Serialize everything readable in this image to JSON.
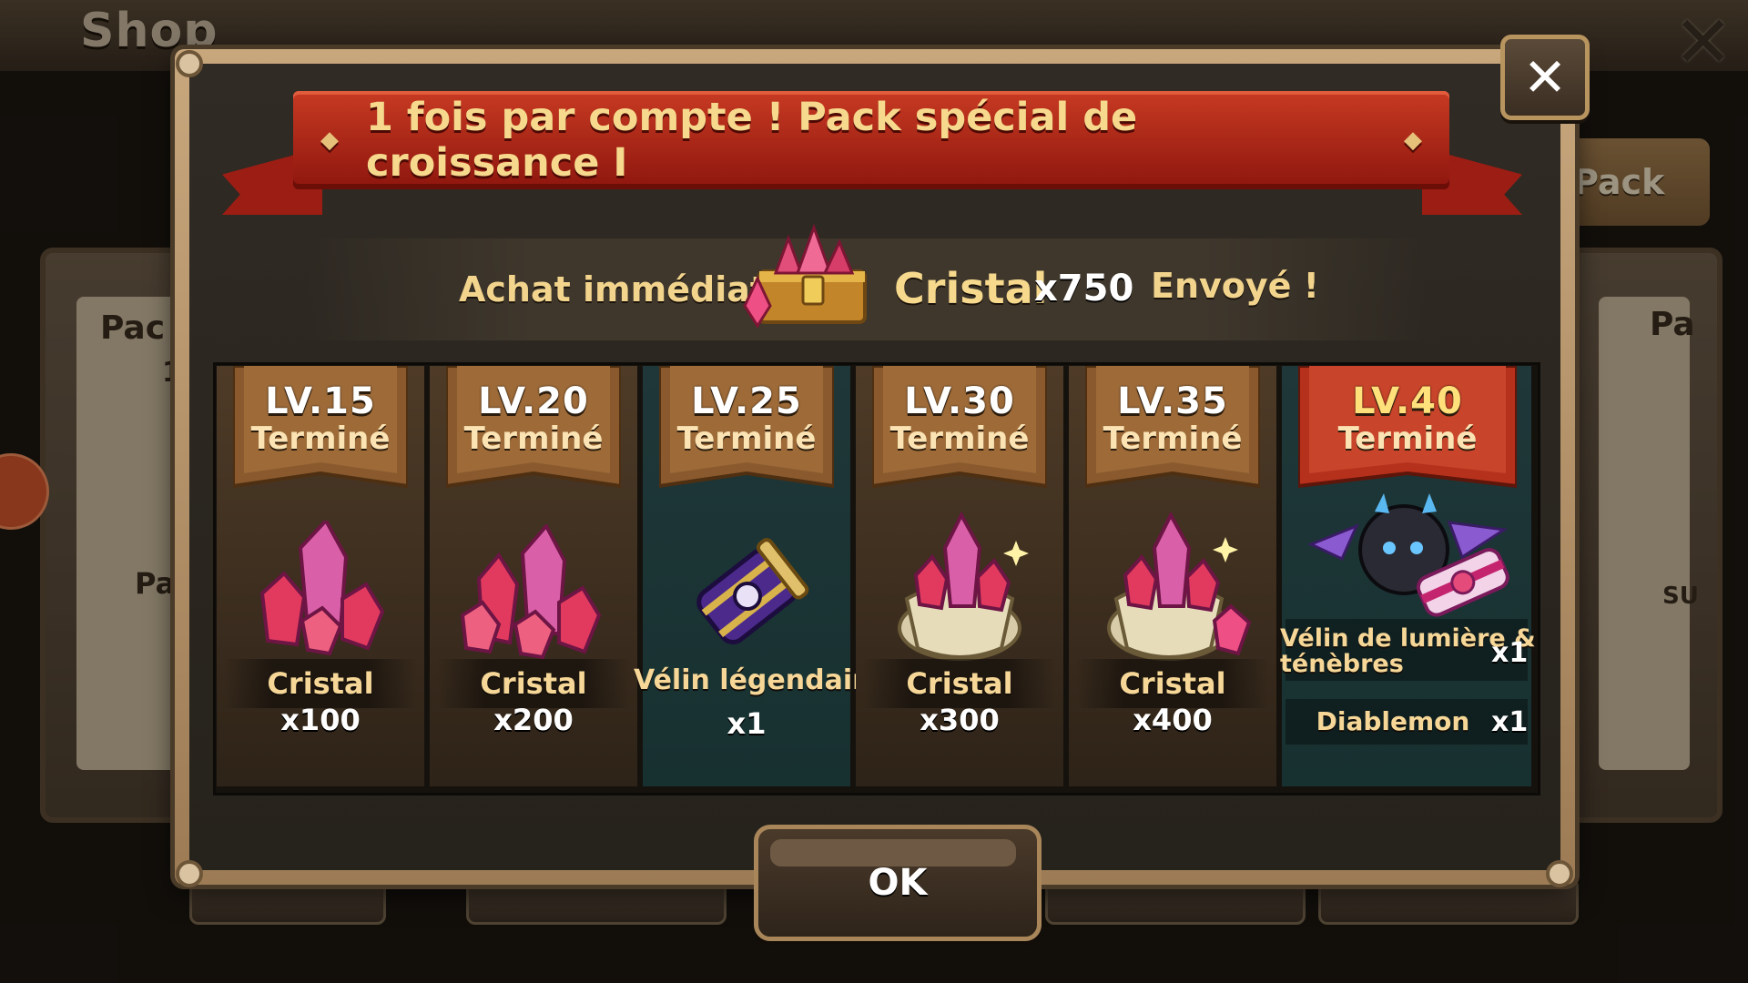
{
  "background": {
    "title": "Shop",
    "pack_tab": "Pack",
    "left_card_label": "Pac",
    "left_card_sub": "1",
    "left_card_label2": "Pac",
    "right_card_label": "Pa",
    "right_card_sub": "SU"
  },
  "dialog": {
    "banner_title": "1 fois par compte ! Pack spécial de croissance I",
    "immediate": {
      "label": "Achat immédiat",
      "item": "Cristal",
      "count": "x750",
      "status": "Envoyé !"
    },
    "rewards": [
      {
        "level": "LV.15",
        "status": "Terminé",
        "name": "Cristal",
        "count": "x100",
        "theme": "brown",
        "icon": "crystal-cluster-icon"
      },
      {
        "level": "LV.20",
        "status": "Terminé",
        "name": "Cristal",
        "count": "x200",
        "theme": "brown",
        "icon": "crystal-cluster-icon"
      },
      {
        "level": "LV.25",
        "status": "Terminé",
        "name": "Vélin légendaire",
        "count": "x1",
        "theme": "teal",
        "icon": "legendary-scroll-icon"
      },
      {
        "level": "LV.30",
        "status": "Terminé",
        "name": "Cristal",
        "count": "x300",
        "theme": "brown",
        "icon": "crystal-sack-icon"
      },
      {
        "level": "LV.35",
        "status": "Terminé",
        "name": "Cristal",
        "count": "x400",
        "theme": "brown",
        "icon": "crystal-sack-icon"
      },
      {
        "level": "LV.40",
        "status": "Terminé",
        "name_line1": "Vélin de lumière &",
        "name_line2": "ténèbres",
        "count": "x1",
        "extra_name": "Diablemon",
        "extra_count": "x1",
        "theme": "teal",
        "icon": "light-dark-scroll-icon"
      }
    ],
    "ok_label": "OK",
    "close_symbol": "✕"
  },
  "colors": {
    "gold_text": "#f6d797",
    "ribbon_red": "#b3281a",
    "banner_brown": "#8a5a2e",
    "banner_red": "#b5311c",
    "crystal_pink": "#e0336a"
  }
}
